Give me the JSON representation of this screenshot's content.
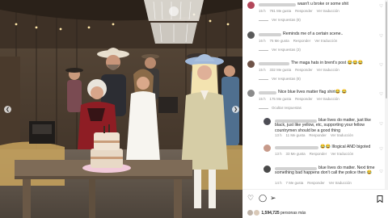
{
  "post": {
    "nav_prev_icon": "chevron-left-icon",
    "nav_next_icon": "chevron-right-icon"
  },
  "comments": [
    {
      "text": "wasn't u broke or some shit",
      "time": "15 h",
      "likes": "781 Me gusta",
      "reply": "Responder",
      "translate": "Ver traducción",
      "replies": "Ver respuestas (8)"
    },
    {
      "text": "Reminds me of a certain scene..",
      "time": "16 h",
      "likes": "76 Me gusta",
      "reply": "Responder",
      "translate": "Ver traducción",
      "replies": "Ver respuestas (3)"
    },
    {
      "text": "The maga hats in brent's post 😂😂😂",
      "time": "15 h",
      "likes": "332 Me gusta",
      "reply": "Responder",
      "translate": "Ver traducción",
      "replies": "Ver respuestas (8)"
    },
    {
      "text": "Nice blue lives matter flag shirt😂 😂",
      "time": "15 h",
      "likes": "175 Me gusta",
      "reply": "Responder",
      "translate": "Ver traducción",
      "replies": "Ocultar respuestas"
    }
  ],
  "sub_comments": [
    {
      "text": "blue lives do matter, just like black, just like yellow, etc, supporting your fellow countrymen should be a good thing",
      "time": "13 h",
      "likes": "11 Me gusta",
      "reply": "Responder",
      "translate": "Ver traducción"
    },
    {
      "text": "😂😂 Illogical AND bigoted",
      "time": "13 h",
      "likes": "33 Me gusta",
      "reply": "Responder",
      "translate": "Ver traducción"
    },
    {
      "text": "blue lives do matter. Next time something bad happens don't call the police then 😂",
      "time": "14 h",
      "likes": "7 Me gusta",
      "reply": "Responder",
      "translate": "Ver traducción"
    }
  ],
  "actions": {
    "like_icon": "heart-icon",
    "comment_icon": "comment-icon",
    "share_icon": "paper-plane-icon",
    "save_icon": "bookmark-icon"
  },
  "likes_summary": {
    "count": "1,594,725",
    "label": "personas más"
  },
  "colors": {
    "text": "#262626",
    "meta": "#8e8e8e",
    "background": "#ffffff"
  }
}
